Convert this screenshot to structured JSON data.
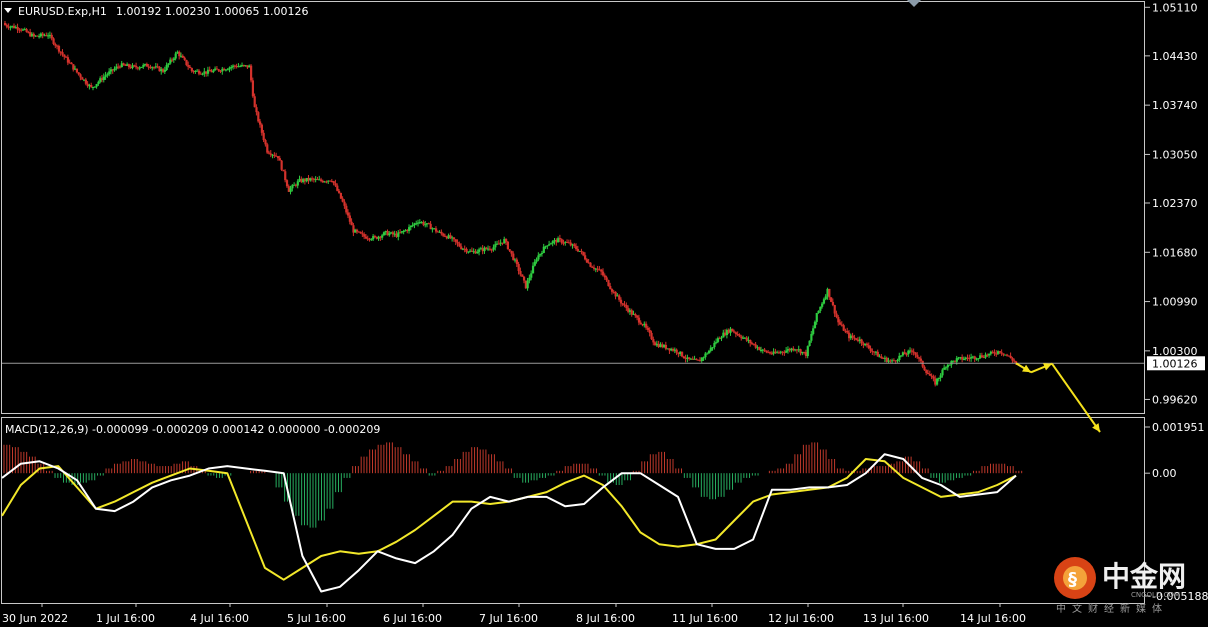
{
  "header": {
    "symbol": "EURUSD.Exp,H1",
    "ohlc": "1.00192 1.00230 1.00065 1.00126"
  },
  "macd_header": "MACD(12,26,9) -0.000099 -0.000209 0.000142 0.000000 -0.000209",
  "watermark": {
    "name_cn": "中金网",
    "site": "CNGOLD.COM",
    "subtitle": "中文财经新媒体"
  },
  "colors": {
    "background": "#000000",
    "bull_candle": "#2ecc40",
    "bear_candle": "#d4322c",
    "macd_positive": "#c0392b",
    "macd_negative": "#27ae60",
    "macd_line": "#ffffff",
    "signal_line": "#f2e82a",
    "arrow": "#f5e11c",
    "grid_frame": "#c8c8c8"
  },
  "chart_data": [
    {
      "type": "candlestick",
      "title": "EURUSD.Exp,H1",
      "xlabel": "",
      "ylabel": "",
      "x_ticks": [
        "30 Jun 2022",
        "1 Jul 16:00",
        "4 Jul 16:00",
        "5 Jul 16:00",
        "6 Jul 16:00",
        "7 Jul 16:00",
        "8 Jul 16:00",
        "11 Jul 16:00",
        "12 Jul 16:00",
        "13 Jul 16:00",
        "14 Jul 16:00"
      ],
      "y_ticks": [
        "1.05110",
        "1.04430",
        "1.03740",
        "1.03050",
        "1.02370",
        "1.01680",
        "1.00990",
        "1.00300",
        "0.99620"
      ],
      "ylim": [
        0.9943,
        1.0517
      ],
      "current_price": 1.00126,
      "current_price_label": "1.00126",
      "close_path": [
        [
          0,
          1.0486
        ],
        [
          8,
          1.0482
        ],
        [
          16,
          1.047
        ],
        [
          24,
          1.0473
        ],
        [
          32,
          1.0445
        ],
        [
          40,
          1.042
        ],
        [
          48,
          1.0398
        ],
        [
          56,
          1.0416
        ],
        [
          64,
          1.043
        ],
        [
          72,
          1.0427
        ],
        [
          80,
          1.043
        ],
        [
          88,
          1.0422
        ],
        [
          96,
          1.0448
        ],
        [
          104,
          1.0422
        ],
        [
          112,
          1.042
        ],
        [
          120,
          1.0424
        ],
        [
          128,
          1.0429
        ],
        [
          136,
          1.0428
        ],
        [
          139,
          1.037
        ],
        [
          146,
          1.031
        ],
        [
          152,
          1.0302
        ],
        [
          158,
          1.0255
        ],
        [
          164,
          1.0268
        ],
        [
          170,
          1.027
        ],
        [
          176,
          1.0268
        ],
        [
          182,
          1.027
        ],
        [
          188,
          1.0238
        ],
        [
          194,
          1.0198
        ],
        [
          200,
          1.019
        ],
        [
          206,
          1.0188
        ],
        [
          212,
          1.0195
        ],
        [
          218,
          1.0192
        ],
        [
          224,
          1.02
        ],
        [
          230,
          1.0212
        ],
        [
          236,
          1.0205
        ],
        [
          242,
          1.0195
        ],
        [
          248,
          1.0188
        ],
        [
          254,
          1.0175
        ],
        [
          260,
          1.0168
        ],
        [
          266,
          1.0172
        ],
        [
          272,
          1.0175
        ],
        [
          278,
          1.0185
        ],
        [
          284,
          1.0155
        ],
        [
          290,
          1.012
        ],
        [
          296,
          1.016
        ],
        [
          302,
          1.018
        ],
        [
          308,
          1.0185
        ],
        [
          314,
          1.018
        ],
        [
          320,
          1.017
        ],
        [
          326,
          1.015
        ],
        [
          332,
          1.014
        ],
        [
          338,
          1.0115
        ],
        [
          344,
          1.0095
        ],
        [
          350,
          1.008
        ],
        [
          356,
          1.0065
        ],
        [
          362,
          1.004
        ],
        [
          368,
          1.0035
        ],
        [
          374,
          1.003
        ],
        [
          380,
          1.0018
        ],
        [
          386,
          1.0015
        ],
        [
          392,
          1.003
        ],
        [
          398,
          1.005
        ],
        [
          404,
          1.006
        ],
        [
          410,
          1.005
        ],
        [
          416,
          1.004
        ],
        [
          422,
          1.003
        ],
        [
          428,
          1.0026
        ],
        [
          434,
          1.003
        ],
        [
          440,
          1.0034
        ],
        [
          446,
          1.0025
        ],
        [
          452,
          1.008
        ],
        [
          458,
          1.0115
        ],
        [
          464,
          1.007
        ],
        [
          470,
          1.005
        ],
        [
          476,
          1.0045
        ],
        [
          482,
          1.0032
        ],
        [
          488,
          1.002
        ],
        [
          494,
          1.0015
        ],
        [
          500,
          1.0025
        ],
        [
          506,
          1.003
        ],
        [
          512,
          1.0005
        ],
        [
          518,
          0.9985
        ],
        [
          524,
          1.001
        ],
        [
          530,
          1.0018
        ],
        [
          536,
          1.002
        ],
        [
          542,
          1.0022
        ],
        [
          548,
          1.0025
        ],
        [
          554,
          1.003
        ],
        [
          560,
          1.002
        ],
        [
          563,
          1.0013
        ]
      ],
      "projection_arrow": [
        [
          1.00126,
          1.0
        ],
        [
          1.0,
          1.0012
        ],
        [
          1.0012,
          0.9955
        ]
      ]
    },
    {
      "type": "macd",
      "title": "MACD(12,26,9)",
      "y_ticks": [
        "0.001951",
        "0.00",
        "-0.005188"
      ],
      "ylim": [
        -0.005188,
        0.001951
      ],
      "histogram": [
        0.0012,
        0.0011,
        0.0009,
        0.0007,
        0.0004,
        0.0001,
        -0.0002,
        -0.0004,
        -0.0005,
        -0.0004,
        -0.0003,
        -0.0001,
        0.0002,
        0.0004,
        0.0005,
        0.0006,
        0.0005,
        0.0004,
        0.0003,
        0.0003,
        0.0004,
        0.0005,
        0.0003,
        0.0001,
        -0.0001,
        -0.0002,
        -0.0001,
        0.0,
        0.0,
        0.0001,
        0.0001,
        0.0,
        -0.0006,
        -0.0012,
        -0.0018,
        -0.0022,
        -0.0023,
        -0.002,
        -0.0015,
        -0.0008,
        -0.0002,
        0.0003,
        0.0007,
        0.001,
        0.0012,
        0.0013,
        0.0011,
        0.0008,
        0.0005,
        0.0002,
        -0.0001,
        0.0001,
        0.0003,
        0.0006,
        0.0009,
        0.0011,
        0.001,
        0.0008,
        0.0005,
        0.0002,
        -0.0002,
        -0.0004,
        -0.0003,
        -0.0002,
        -0.0001,
        0.0001,
        0.0003,
        0.0004,
        0.0004,
        0.0002,
        -0.0001,
        -0.0004,
        -0.0005,
        -0.0003,
        0.0001,
        0.0005,
        0.0008,
        0.0009,
        0.0006,
        0.0002,
        -0.0002,
        -0.0006,
        -0.001,
        -0.0011,
        -0.001,
        -0.0007,
        -0.0004,
        -0.0002,
        -0.0001,
        0.0,
        0.0001,
        0.0002,
        0.0004,
        0.0008,
        0.0012,
        0.0013,
        0.001,
        0.0006,
        0.0002,
        0.0001,
        0.0001,
        0.0002,
        0.0003,
        0.0003,
        0.0004,
        0.0005,
        0.0007,
        0.0005,
        0.0002,
        -0.0002,
        -0.0004,
        -0.0003,
        -0.0002,
        -0.0001,
        0.0001,
        0.0003,
        0.0004,
        0.0004,
        0.0003,
        0.0001
      ],
      "macd_line": [
        -0.0002,
        0.0004,
        0.0005,
        0.0002,
        -0.0003,
        -0.0015,
        -0.0016,
        -0.0012,
        -0.0006,
        -0.0003,
        -0.0001,
        0.0002,
        0.0003,
        0.0002,
        0.0001,
        0.0,
        -0.0035,
        -0.005,
        -0.0048,
        -0.0041,
        -0.0033,
        -0.0036,
        -0.0038,
        -0.0033,
        -0.0026,
        -0.0015,
        -0.001,
        -0.0012,
        -0.001,
        -0.001,
        -0.0014,
        -0.0013,
        -0.0006,
        0.0,
        0.0,
        -0.0005,
        -0.001,
        -0.003,
        -0.0032,
        -0.0032,
        -0.0028,
        -0.0007,
        -0.0007,
        -0.0006,
        -0.0006,
        -0.0005,
        0.0,
        0.0008,
        0.0006,
        -0.0002,
        -0.0005,
        -0.001,
        -0.0009,
        -0.0008,
        -0.0001
      ],
      "signal_line": [
        -0.0018,
        -0.0005,
        0.0002,
        0.0003,
        -0.0006,
        -0.0015,
        -0.0012,
        -0.0008,
        -0.0004,
        -0.0001,
        0.0002,
        0.0001,
        0.0,
        -0.002,
        -0.004,
        -0.0045,
        -0.004,
        -0.0035,
        -0.0033,
        -0.0034,
        -0.0033,
        -0.0029,
        -0.0024,
        -0.0018,
        -0.0012,
        -0.0012,
        -0.0013,
        -0.0012,
        -0.001,
        -0.0008,
        -0.0004,
        -0.0001,
        -0.0005,
        -0.0014,
        -0.0025,
        -0.003,
        -0.0031,
        -0.003,
        -0.0028,
        -0.002,
        -0.0012,
        -0.0009,
        -0.0008,
        -0.0007,
        -0.0006,
        -0.0002,
        0.0006,
        0.0005,
        -0.0002,
        -0.0006,
        -0.001,
        -0.0009,
        -0.0008,
        -0.0005,
        -0.0001
      ]
    }
  ]
}
